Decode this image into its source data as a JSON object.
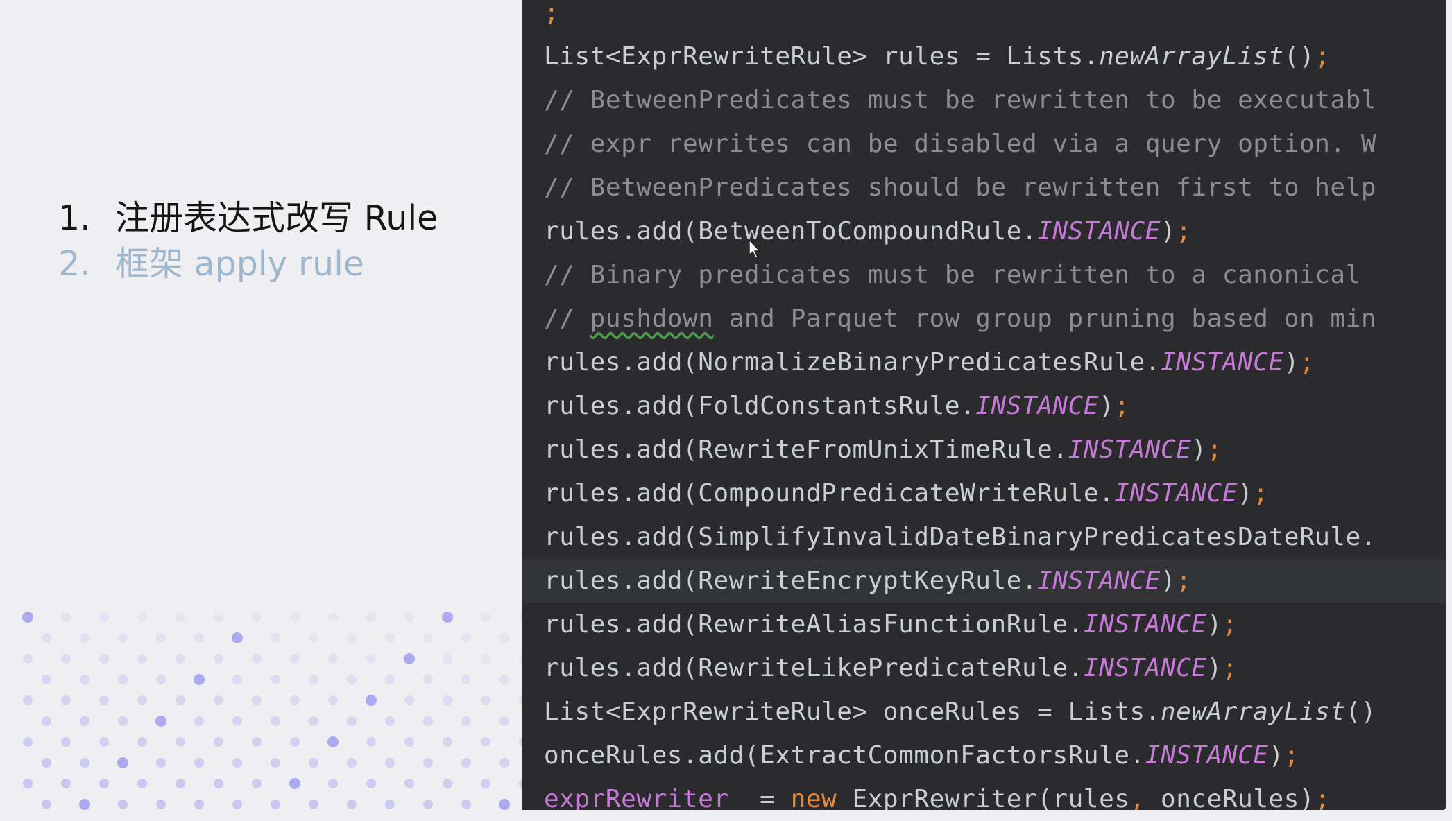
{
  "slide": {
    "agenda": [
      {
        "number": "1.",
        "text": "注册表达式改写 Rule",
        "state": "active"
      },
      {
        "number": "2.",
        "text": "框架 apply rule",
        "state": "inactive"
      }
    ]
  },
  "colors": {
    "background": "#efeff1",
    "editor_background": "#2b2b2d",
    "comment": "#8a8d92",
    "constant_italic": "#c57ad8",
    "punctuation_semicolon": "#e48a3c",
    "keyword_new": "#e48a3c",
    "dots": "#9f9cf0"
  },
  "code": {
    "lines": [
      {
        "tokens": [
          {
            "text": "",
            "type": "plain"
          },
          {
            "text": ";",
            "type": "semi"
          }
        ]
      },
      {
        "tokens": [
          {
            "text": "List<ExprRewriteRule> rules = Lists.",
            "type": "plain"
          },
          {
            "text": "newArrayList",
            "type": "italic-plain"
          },
          {
            "text": "()",
            "type": "plain"
          },
          {
            "text": ";",
            "type": "semi"
          }
        ]
      },
      {
        "tokens": [
          {
            "text": "// BetweenPredicates must be rewritten to be executabl",
            "type": "comment"
          }
        ]
      },
      {
        "tokens": [
          {
            "text": "// expr rewrites can be disabled via a query option. W",
            "type": "comment"
          }
        ]
      },
      {
        "tokens": [
          {
            "text": "// BetweenPredicates should be rewritten first to help",
            "type": "comment"
          }
        ]
      },
      {
        "tokens": [
          {
            "text": "rules.add(BetweenToCompoundRule.",
            "type": "plain"
          },
          {
            "text": "INSTANCE",
            "type": "italic"
          },
          {
            "text": ")",
            "type": "plain"
          },
          {
            "text": ";",
            "type": "semi"
          }
        ]
      },
      {
        "tokens": [
          {
            "text": "// Binary predicates must be rewritten to a canonical",
            "type": "comment"
          }
        ]
      },
      {
        "tokens": [
          {
            "text": "// ",
            "type": "comment"
          },
          {
            "text": "pushdown",
            "type": "comment-squiggle"
          },
          {
            "text": " and Parquet row group pruning based on min",
            "type": "comment"
          }
        ]
      },
      {
        "tokens": [
          {
            "text": "rules.add(NormalizeBinaryPredicatesRule.",
            "type": "plain"
          },
          {
            "text": "INSTANCE",
            "type": "italic"
          },
          {
            "text": ")",
            "type": "plain"
          },
          {
            "text": ";",
            "type": "semi"
          }
        ]
      },
      {
        "tokens": [
          {
            "text": "rules.add(FoldConstantsRule.",
            "type": "plain"
          },
          {
            "text": "INSTANCE",
            "type": "italic"
          },
          {
            "text": ")",
            "type": "plain"
          },
          {
            "text": ";",
            "type": "semi"
          }
        ]
      },
      {
        "tokens": [
          {
            "text": "rules.add(RewriteFromUnixTimeRule.",
            "type": "plain"
          },
          {
            "text": "INSTANCE",
            "type": "italic"
          },
          {
            "text": ")",
            "type": "plain"
          },
          {
            "text": ";",
            "type": "semi"
          }
        ]
      },
      {
        "tokens": [
          {
            "text": "rules.add(CompoundPredicateWriteRule.",
            "type": "plain"
          },
          {
            "text": "INSTANCE",
            "type": "italic"
          },
          {
            "text": ")",
            "type": "plain"
          },
          {
            "text": ";",
            "type": "semi"
          }
        ]
      },
      {
        "tokens": [
          {
            "text": "rules.add(SimplifyInvalidDateBinaryPredicatesDateRule.",
            "type": "plain"
          }
        ]
      },
      {
        "highlight": true,
        "tokens": [
          {
            "text": "rules.add(RewriteEncryptKeyRule.",
            "type": "plain"
          },
          {
            "text": "INSTANCE",
            "type": "italic"
          },
          {
            "text": ")",
            "type": "plain"
          },
          {
            "text": ";",
            "type": "semi"
          }
        ]
      },
      {
        "tokens": [
          {
            "text": "rules.add(RewriteAliasFunctionRule.",
            "type": "plain"
          },
          {
            "text": "INSTANCE",
            "type": "italic"
          },
          {
            "text": ")",
            "type": "plain"
          },
          {
            "text": ";",
            "type": "semi"
          }
        ]
      },
      {
        "tokens": [
          {
            "text": "rules.add(RewriteLikePredicateRule.",
            "type": "plain"
          },
          {
            "text": "INSTANCE",
            "type": "italic"
          },
          {
            "text": ")",
            "type": "plain"
          },
          {
            "text": ";",
            "type": "semi"
          }
        ]
      },
      {
        "tokens": [
          {
            "text": "List<ExprRewriteRule> onceRules = Lists.",
            "type": "plain"
          },
          {
            "text": "newArrayList",
            "type": "italic-plain"
          },
          {
            "text": "()",
            "type": "plain"
          }
        ]
      },
      {
        "tokens": [
          {
            "text": "onceRules.add(ExtractCommonFactorsRule.",
            "type": "plain"
          },
          {
            "text": "INSTANCE",
            "type": "italic"
          },
          {
            "text": ")",
            "type": "plain"
          },
          {
            "text": ";",
            "type": "semi"
          }
        ]
      },
      {
        "tokens": [
          {
            "text": "exprRewriter_",
            "type": "field"
          },
          {
            "text": " = ",
            "type": "plain"
          },
          {
            "text": "new",
            "type": "kw"
          },
          {
            "text": " ExprRewriter(rules",
            "type": "plain"
          },
          {
            "text": ",",
            "type": "semi"
          },
          {
            "text": " onceRules)",
            "type": "plain"
          },
          {
            "text": ";",
            "type": "semi"
          }
        ]
      }
    ]
  },
  "cursor": {
    "icon": "mouse-pointer-icon"
  }
}
